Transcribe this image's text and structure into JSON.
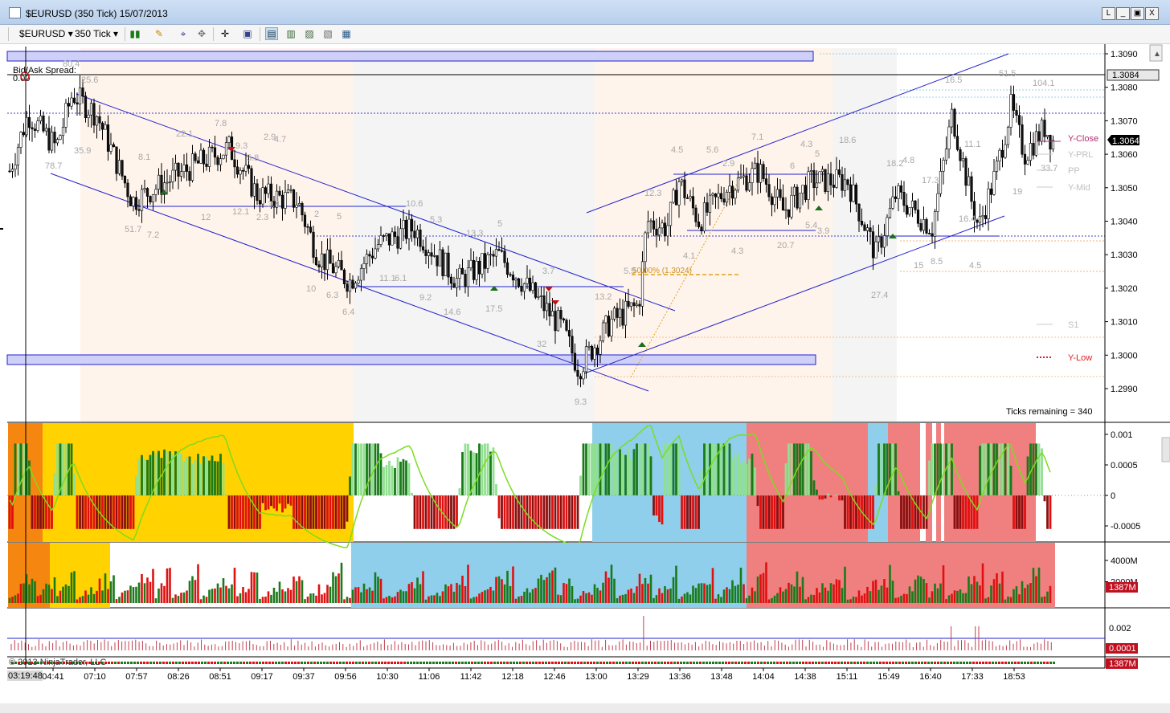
{
  "window": {
    "title": "$EURUSD (350 Tick)  15/07/2013",
    "buttons": [
      "L",
      "_",
      "▣",
      "X"
    ]
  },
  "toolbar": {
    "instrument": "$EURUSD",
    "interval": "350 Tick"
  },
  "chart_data": {
    "type": "candlestick",
    "price_axis": {
      "ticks": [
        "1.3090",
        "1.3080",
        "1.3070",
        "1.3060",
        "1.3050",
        "1.3040",
        "1.3030",
        "1.3020",
        "1.3010",
        "1.3000",
        "1.2990"
      ],
      "last_price": "1.3064",
      "marker_price": "1.3084"
    },
    "time_axis": {
      "ticks": [
        "04:41",
        "07:10",
        "07:57",
        "08:26",
        "08:51",
        "09:17",
        "09:37",
        "09:56",
        "10:30",
        "11:06",
        "11:42",
        "12:18",
        "12:46",
        "13:00",
        "13:29",
        "13:36",
        "13:48",
        "14:04",
        "14:38",
        "15:11",
        "15:49",
        "16:40",
        "17:33",
        "18:53"
      ],
      "cursor_time": "03:19:48"
    },
    "bid_ask_label": "Bid/Ask Spread:",
    "bid_ask_value": "0.00",
    "ticks_remaining": "Ticks remaining = 340",
    "fib_label": "50.00% (1.3024)",
    "levels": [
      "Y-Close",
      "Y-PRL",
      "PP",
      "Y-Mid",
      "S1",
      "Y-Low"
    ],
    "annotations": [
      "80.4",
      "25.6",
      "35.9",
      "78.7",
      "8.1",
      "22.1",
      "7.8",
      "2.9",
      "4.7",
      "9.3",
      "5.8",
      "12",
      "12.1",
      "2.3",
      "3.4",
      "2",
      "5",
      "51.7",
      "7.2",
      "10.6",
      "5.3",
      "5",
      "13.3",
      "11.1",
      "6.1",
      "9.2",
      "14.6",
      "17.5",
      "3.7",
      "10",
      "6.3",
      "6.4",
      "13.2",
      "32",
      "9.3",
      "5.5",
      "12.3",
      "4.5",
      "5.6",
      "7.1",
      "4.3",
      "5",
      "18.6",
      "2.9",
      "6",
      "4.1",
      "4.3",
      "20.7",
      "5.4",
      "3.9",
      "18.2",
      "4.8",
      "17.3",
      "11.1",
      "16.4",
      "51.5",
      "104.1",
      "33.7",
      "19",
      "15",
      "8.5",
      "4.5",
      "27.4",
      "16.5"
    ],
    "osc_axis": [
      "0.001",
      "0.0005",
      "0",
      "-0.0005"
    ],
    "volume_axis": [
      "4000M",
      "2000M"
    ],
    "volume_last": "1387M",
    "spread_axis": [
      "0.002"
    ],
    "spread_last": "0.0001",
    "bottom_last": "1387M",
    "copyright": "© 2013 NinjaTrader, LLC"
  }
}
